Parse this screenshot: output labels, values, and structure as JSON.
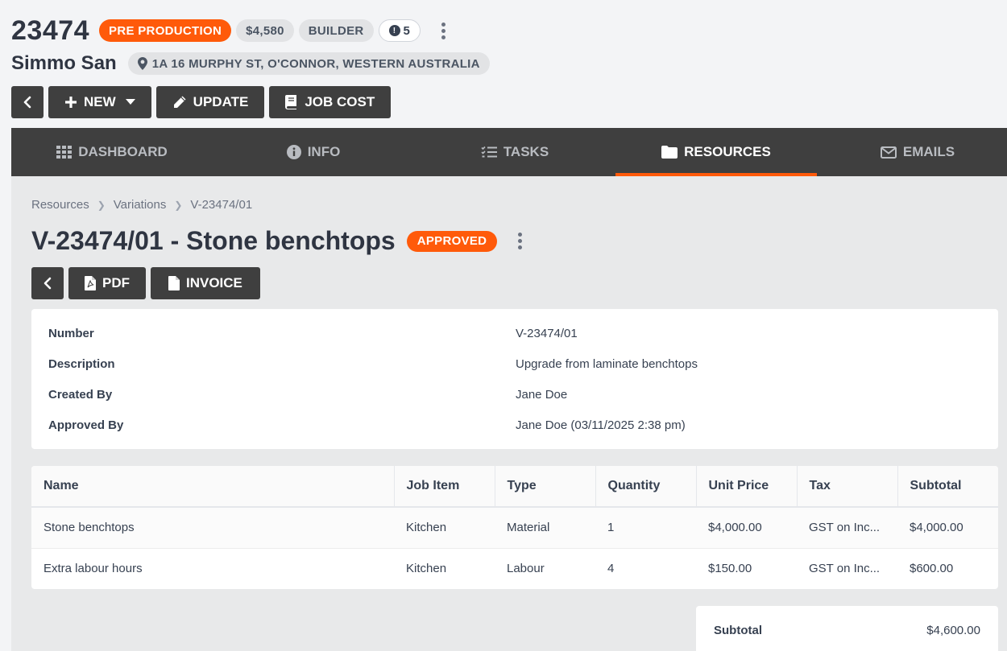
{
  "job": {
    "number": "23474",
    "stage": "PRE PRODUCTION",
    "amount": "$4,580",
    "role": "BUILDER",
    "alerts": "5",
    "client": "Simmo San",
    "address": "1A 16 MURPHY ST, O'CONNOR, WESTERN AUSTRALIA"
  },
  "toolbar": {
    "new_label": "NEW",
    "update_label": "UPDATE",
    "jobcost_label": "JOB COST"
  },
  "tabs": [
    {
      "label": "DASHBOARD",
      "icon": "grid-icon"
    },
    {
      "label": "INFO",
      "icon": "info-icon"
    },
    {
      "label": "TASKS",
      "icon": "tasks-icon"
    },
    {
      "label": "RESOURCES",
      "icon": "folder-icon",
      "active": true
    },
    {
      "label": "EMAILS",
      "icon": "envelope-icon"
    }
  ],
  "breadcrumb": [
    "Resources",
    "Variations",
    "V-23474/01"
  ],
  "variation": {
    "title": "V-23474/01 - Stone benchtops",
    "status": "APPROVED",
    "pdf_label": "PDF",
    "invoice_label": "INVOICE"
  },
  "details": [
    {
      "label": "Number",
      "value": "V-23474/01"
    },
    {
      "label": "Description",
      "value": "Upgrade from laminate benchtops"
    },
    {
      "label": "Created By",
      "value": "Jane Doe"
    },
    {
      "label": "Approved By",
      "value": "Jane Doe (03/11/2025 2:38 pm)"
    }
  ],
  "items_table": {
    "headers": [
      "Name",
      "Job Item",
      "Type",
      "Quantity",
      "Unit Price",
      "Tax",
      "Subtotal"
    ],
    "rows": [
      [
        "Stone benchtops",
        "Kitchen",
        "Material",
        "1",
        "$4,000.00",
        "GST on Inc...",
        "$4,000.00"
      ],
      [
        "Extra labour hours",
        "Kitchen",
        "Labour",
        "4",
        "$150.00",
        "GST on Inc...",
        "$600.00"
      ]
    ]
  },
  "totals": {
    "subtotal_label": "Subtotal",
    "subtotal_value": "$4,600.00"
  },
  "colors": {
    "accent": "#ff5a0a",
    "dark": "#3f3f3f"
  }
}
